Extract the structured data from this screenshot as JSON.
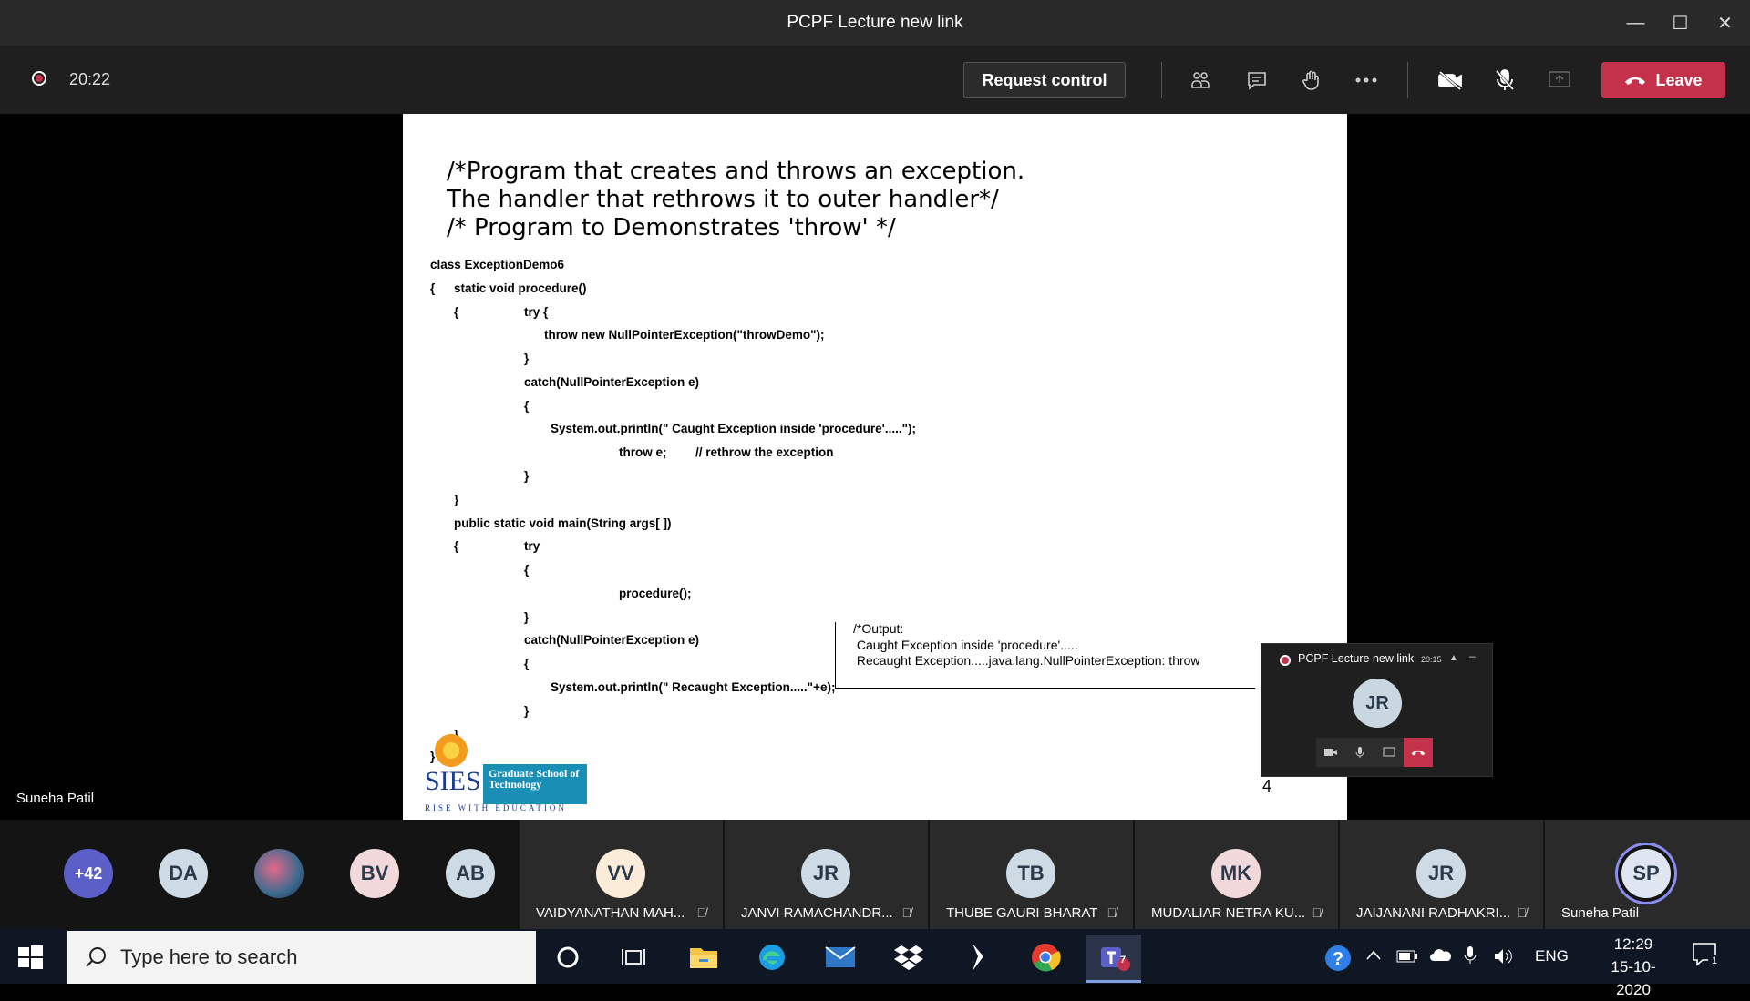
{
  "window": {
    "title": "PCPF Lecture new link"
  },
  "toolbar": {
    "timer": "20:22",
    "request_control_label": "Request control",
    "leave_label": "Leave"
  },
  "slide": {
    "comment_lines": [
      "/*Program that creates and throws an exception.",
      "The handler that rethrows it to outer handler*/",
      "/* Program to Demonstrates 'throw' */"
    ],
    "code": [
      "class ExceptionDemo6",
      "{",
      "static void procedure()",
      "{",
      "try {",
      "throw new NullPointerException(\"throwDemo\");",
      "}",
      "catch(NullPointerException e)",
      "{",
      "System.out.println(\" Caught Exception inside 'procedure'.....\");",
      "throw e;",
      "// rethrow the exception",
      "}",
      "}",
      "public static void main(String args[ ])",
      "{",
      "try",
      "{",
      "procedure();",
      "}",
      "catch(NullPointerException e)",
      "{",
      "System.out.println(\" Recaught Exception.....\"+e);",
      "}",
      "}",
      "}"
    ],
    "output_lines": [
      "/*Output:",
      " Caught Exception inside 'procedure'.....",
      " Recaught Exception.....java.lang.NullPointerException: throw"
    ],
    "page_number": "4",
    "logo": {
      "brand": "SIES",
      "school": "Graduate School of Technology",
      "tagline": "RISE WITH EDUCATION"
    }
  },
  "presenter_name": "Suneha Patil",
  "mini_window": {
    "title": "PCPF Lecture new link",
    "time": "20:15",
    "initials": "JR"
  },
  "participants": {
    "overflow_count": "+42",
    "small_avatars": [
      {
        "initials": "DA",
        "color": "#cfdbe4"
      },
      {
        "initials": "",
        "color": "#3b6b8f"
      },
      {
        "initials": "BV",
        "color": "#f1d8da"
      },
      {
        "initials": "AB",
        "color": "#cfdbe4"
      }
    ],
    "tiles": [
      {
        "initials": "VV",
        "name": "VAIDYANATHAN MAH...",
        "color": "#fbecd9"
      },
      {
        "initials": "JR",
        "name": "JANVI RAMACHANDR...",
        "color": "#cfdbe4"
      },
      {
        "initials": "TB",
        "name": "THUBE GAURI BHARAT",
        "color": "#cfdbe4"
      },
      {
        "initials": "MK",
        "name": "MUDALIAR NETRA KU...",
        "color": "#f1d8da"
      },
      {
        "initials": "JR",
        "name": "JAIJANANI RADHAKRI...",
        "color": "#cfdbe4"
      },
      {
        "initials": "SP",
        "name": "Suneha Patil",
        "color": "#dfe6f2"
      }
    ]
  },
  "taskbar": {
    "search_placeholder": "Type here to search",
    "teams_badge": "7",
    "language": "ENG",
    "time": "12:29",
    "date": "15-10-2020",
    "notification_count": "1"
  }
}
